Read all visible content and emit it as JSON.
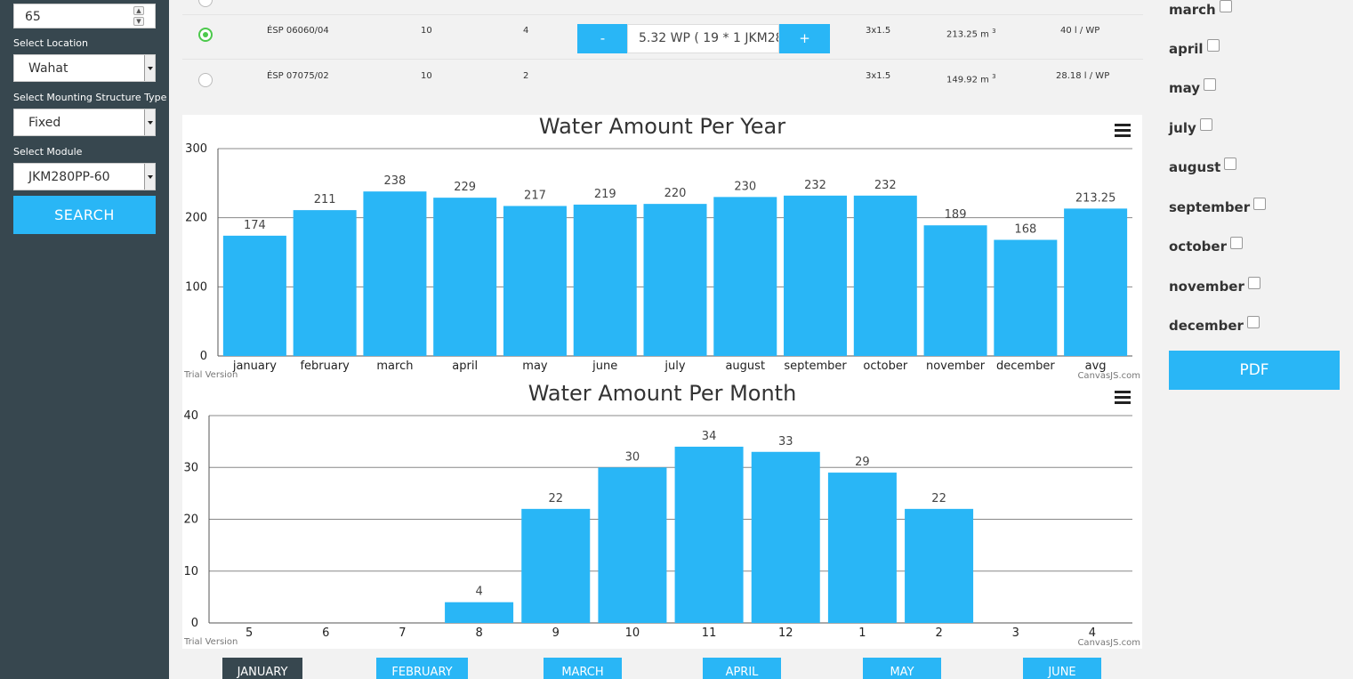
{
  "sidebar": {
    "number_value": "65",
    "location_label": "Select Location",
    "location_value": "Wahat",
    "mounting_label": "Select Mounting Structure Type",
    "mounting_value": "Fixed",
    "module_label": "Select Module",
    "module_value": "JKM280PP-60",
    "search_label": "SEARCH"
  },
  "rows": [
    {
      "model": "ÉSP 06060/04",
      "col2": "10",
      "col3": "4",
      "stepper_minus": "-",
      "stepper_value": "5.32 WP  ( 19 * 1 JKM28",
      "stepper_plus": "+",
      "cable": "3x1.5",
      "volume": "213.25 m",
      "volume_unit": "3",
      "ratio": "40 l / WP",
      "selected": true
    },
    {
      "model": "ÉSP 07075/02",
      "col2": "10",
      "col3": "2",
      "cable": "3x1.5",
      "volume": "149.92 m",
      "volume_unit": "3",
      "ratio": "28.18 l / WP",
      "selected": false
    }
  ],
  "right_panel": {
    "months": [
      "march",
      "april",
      "may",
      "july",
      "august",
      "september",
      "october",
      "november",
      "december"
    ],
    "pdf_label": "PDF"
  },
  "tabs": [
    {
      "label": "JANUARY",
      "active": true
    },
    {
      "label": "FEBRUARY",
      "active": false
    },
    {
      "label": "MARCH",
      "active": false
    },
    {
      "label": "APRIL",
      "active": false
    },
    {
      "label": "MAY",
      "active": false
    },
    {
      "label": "JUNE",
      "active": false
    }
  ],
  "chart_meta": {
    "trial_text": "Trial Version",
    "credit_text": "CanvasJS.com",
    "bar_color": "#29b6f6"
  },
  "chart_data": [
    {
      "type": "bar",
      "title": "Water Amount Per Year",
      "categories": [
        "january",
        "february",
        "march",
        "april",
        "may",
        "june",
        "july",
        "august",
        "september",
        "october",
        "november",
        "december",
        "avg"
      ],
      "values": [
        174,
        211,
        238,
        229,
        217,
        219,
        220,
        230,
        232,
        232,
        189,
        168,
        213.25
      ],
      "labels": [
        "174",
        "211",
        "238",
        "229",
        "217",
        "219",
        "220",
        "230",
        "232",
        "232",
        "189",
        "168",
        "213.25"
      ],
      "ylim": [
        0,
        300
      ],
      "yticks": [
        0,
        100,
        200,
        300
      ],
      "grid": true
    },
    {
      "type": "bar",
      "title": "Water Amount Per Month",
      "categories": [
        "5",
        "6",
        "7",
        "8",
        "9",
        "10",
        "11",
        "12",
        "1",
        "2",
        "3",
        "4"
      ],
      "values": [
        0,
        0,
        0,
        4,
        22,
        30,
        34,
        33,
        29,
        22,
        0,
        0
      ],
      "labels": [
        "",
        "",
        "",
        "4",
        "22",
        "30",
        "34",
        "33",
        "29",
        "22",
        "",
        ""
      ],
      "ylim": [
        0,
        40
      ],
      "yticks": [
        0,
        10,
        20,
        30,
        40
      ],
      "grid": true
    }
  ]
}
